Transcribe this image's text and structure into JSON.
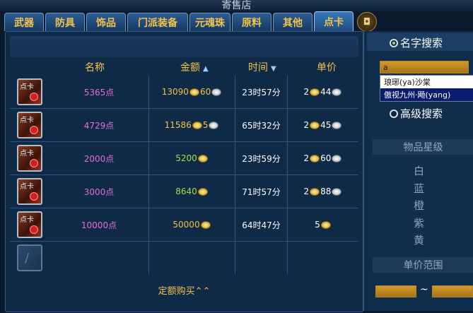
{
  "window": {
    "title": "寄售店"
  },
  "tabs": [
    "武器",
    "防具",
    "饰品",
    "门派装备",
    "元魂珠",
    "原料",
    "其他",
    "点卡"
  ],
  "active_tab": "点卡",
  "columns": {
    "name": "名称",
    "price": "金额",
    "time": "时间",
    "unit": "单价",
    "price_sort": "▲",
    "time_sort": "▼"
  },
  "listings": [
    {
      "icon_label": "点卡",
      "name": "5365点",
      "price_gold": "13090",
      "price_silver": "60",
      "time": "23时57分",
      "unit_gold": "2",
      "unit_silver": "44"
    },
    {
      "icon_label": "点卡",
      "name": "4729点",
      "price_gold": "11586",
      "price_silver": "5",
      "time": "65时32分",
      "unit_gold": "2",
      "unit_silver": "45"
    },
    {
      "icon_label": "点卡",
      "name": "2000点",
      "price_gold": "5200",
      "price_silver": "",
      "time": "23时59分",
      "unit_gold": "2",
      "unit_silver": "60"
    },
    {
      "icon_label": "点卡",
      "name": "3000点",
      "price_gold": "8640",
      "price_silver": "",
      "time": "71时57分",
      "unit_gold": "2",
      "unit_silver": "88"
    },
    {
      "icon_label": "点卡",
      "name": "10000点",
      "price_gold": "50000",
      "price_silver": "",
      "time": "64时47分",
      "unit_gold": "5",
      "unit_silver": ""
    }
  ],
  "footer": {
    "fixed_buy": "定额购买",
    "fixed_buy_icon": "⌃⌃"
  },
  "side": {
    "name_search": "名字搜索",
    "search_value": "a",
    "suggestions": [
      "琅琊(ya)沙棠",
      "傲视九州·飏(yang)"
    ],
    "advanced_search": "高级搜索",
    "grade_title": "物品星级",
    "grades": [
      "白",
      "蓝",
      "橙",
      "紫",
      "黄"
    ],
    "range_title": "单价范围",
    "range_sep": "~"
  },
  "colors": {
    "tab_text": "#f2c34a",
    "item_name": "#e66cd8",
    "price_gold_text": "#f2c34a",
    "price_green_text": "#9fe04a"
  }
}
